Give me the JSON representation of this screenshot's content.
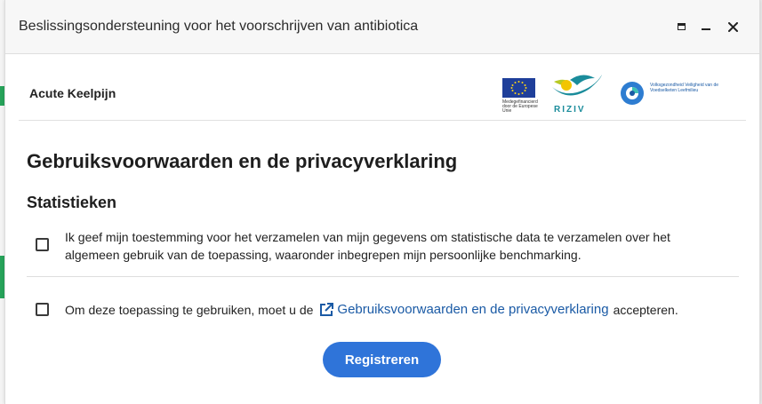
{
  "window": {
    "title": "Beslissingsondersteuning voor het voorschrijven van antibiotica",
    "controls": [
      "maximize-icon",
      "minimize-icon",
      "close-icon"
    ]
  },
  "header": {
    "app_name": "Acute Keelpijn",
    "logos": {
      "eu_caption": "Medegefinancierd door de Europese Unie",
      "riziv": "RIZIV",
      "fagg_caption": "Volksgezondheid Veiligheid van de Voedselketen Leefmilieu"
    }
  },
  "main": {
    "heading": "Gebruiksvoorwaarden en de privacyverklaring",
    "section_title": "Statistieken",
    "consent_text": "Ik geef mijn toestemming voor het verzamelen van mijn gegevens om statistische data te verzamelen over het algemeen gebruik van de toepassing, waaronder inbegrepen mijn persoonlijke benchmarking.",
    "consent_checked": false,
    "terms_prefix": "Om deze toepassing te gebruiken, moet u de",
    "terms_link": "Gebruiksvoorwaarden en de privacyverklaring",
    "terms_suffix": "accepteren.",
    "terms_checked": false,
    "register_button": "Registreren"
  },
  "colors": {
    "accent": "#2f74d9",
    "link": "#1a5aa5"
  }
}
